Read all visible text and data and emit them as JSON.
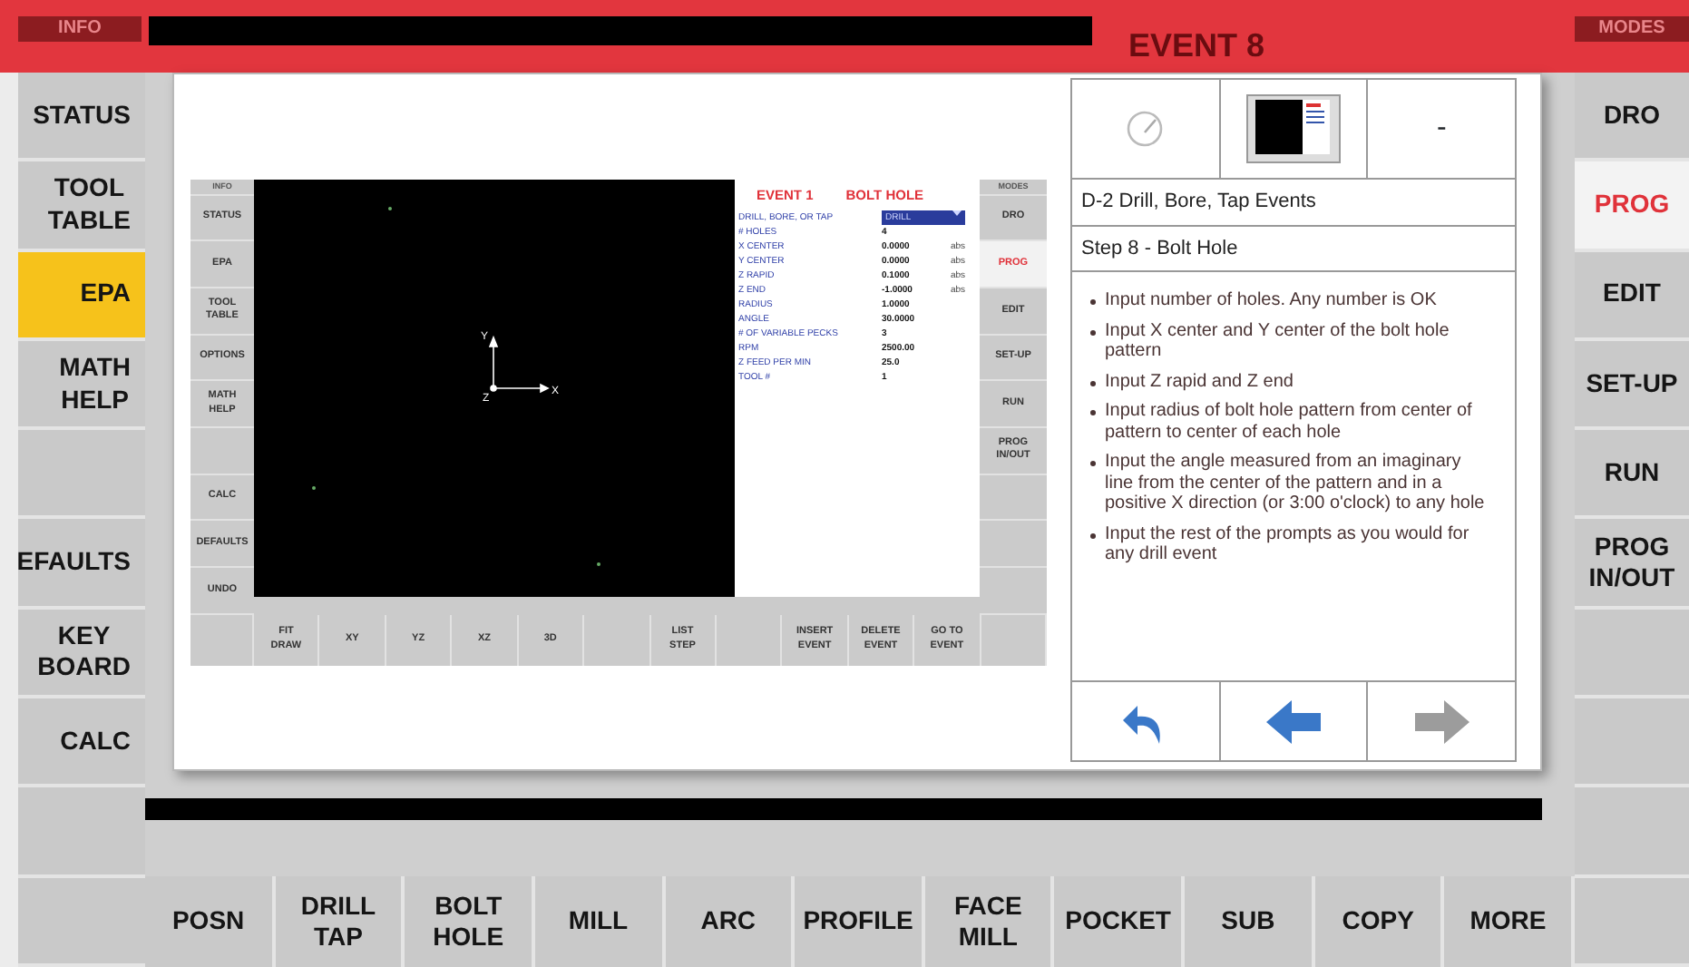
{
  "header": {
    "left_tag": "INFO",
    "event_title": "EVENT 8",
    "right_tag": "MODES"
  },
  "left_menu": [
    {
      "kind": "button",
      "label": "STATUS",
      "selected": false
    },
    {
      "kind": "button",
      "label": "TOOL\nTABLE",
      "selected": false
    },
    {
      "kind": "button",
      "label": "EPA",
      "selected": true
    },
    {
      "kind": "button",
      "label": "MATH\nHELP",
      "selected": false
    },
    {
      "kind": "blank"
    },
    {
      "kind": "button",
      "label": "EFAULTS",
      "selected": false
    },
    {
      "kind": "button",
      "label": "KEY\nBOARD",
      "selected": false
    },
    {
      "kind": "button",
      "label": "CALC",
      "selected": false
    },
    {
      "kind": "blank"
    },
    {
      "kind": "blank"
    }
  ],
  "right_menu": [
    {
      "kind": "button",
      "label": "DRO",
      "selected": false
    },
    {
      "kind": "button",
      "label": "PROG",
      "selected": true
    },
    {
      "kind": "button",
      "label": "EDIT",
      "selected": false
    },
    {
      "kind": "button",
      "label": "SET-UP",
      "selected": false
    },
    {
      "kind": "button",
      "label": "RUN",
      "selected": false
    },
    {
      "kind": "button",
      "label": "PROG\nIN/OUT",
      "selected": false
    },
    {
      "kind": "blank"
    },
    {
      "kind": "blank"
    },
    {
      "kind": "blank"
    },
    {
      "kind": "blank"
    }
  ],
  "inner_screen": {
    "left_menu": [
      {
        "kind": "tag",
        "label": "INFO"
      },
      {
        "kind": "button",
        "label": "STATUS"
      },
      {
        "kind": "button",
        "label": "EPA"
      },
      {
        "kind": "button",
        "label": "TOOL\nTABLE"
      },
      {
        "kind": "button",
        "label": "OPTIONS"
      },
      {
        "kind": "button",
        "label": "MATH\nHELP"
      },
      {
        "kind": "blank"
      },
      {
        "kind": "button",
        "label": "CALC"
      },
      {
        "kind": "button",
        "label": "DEFAULTS"
      },
      {
        "kind": "button",
        "label": "UNDO"
      }
    ],
    "axis_labels": {
      "y": "Y",
      "x": "X",
      "z": "Z"
    },
    "event": {
      "number": "EVENT 1",
      "name": "BOLT HOLE"
    },
    "fields": [
      {
        "kind": "dropdown",
        "label": "DRILL, BORE, OR TAP",
        "value": "DRILL"
      },
      {
        "kind": "value",
        "label": "# HOLES",
        "value": "4"
      },
      {
        "kind": "value",
        "label": "X CENTER",
        "value": "0.0000",
        "unit": "abs"
      },
      {
        "kind": "value",
        "label": "Y CENTER",
        "value": "0.0000",
        "unit": "abs"
      },
      {
        "kind": "value",
        "label": "Z RAPID",
        "value": "0.1000",
        "unit": "abs"
      },
      {
        "kind": "value",
        "label": "Z END",
        "value": "-1.0000",
        "unit": "abs"
      },
      {
        "kind": "value",
        "label": "RADIUS",
        "value": "1.0000"
      },
      {
        "kind": "value",
        "label": "ANGLE",
        "value": "30.0000"
      },
      {
        "kind": "value",
        "label": "# OF VARIABLE PECKS",
        "value": "3"
      },
      {
        "kind": "value",
        "label": "RPM",
        "value": "2500.00"
      },
      {
        "kind": "value",
        "label": "Z FEED PER MIN",
        "value": "25.0"
      },
      {
        "kind": "value",
        "label": "TOOL #",
        "value": "1"
      }
    ],
    "right_menu": [
      {
        "kind": "tag",
        "label": "MODES"
      },
      {
        "kind": "button",
        "label": "DRO",
        "selected": false
      },
      {
        "kind": "button",
        "label": "PROG",
        "selected": true
      },
      {
        "kind": "button",
        "label": "EDIT",
        "selected": false
      },
      {
        "kind": "button",
        "label": "SET-UP",
        "selected": false
      },
      {
        "kind": "button",
        "label": "RUN",
        "selected": false
      },
      {
        "kind": "button",
        "label": "PROG\nIN/OUT",
        "selected": false
      },
      {
        "kind": "blank"
      },
      {
        "kind": "blank"
      },
      {
        "kind": "blank"
      }
    ],
    "toolbar": [
      {
        "kind": "blank"
      },
      {
        "kind": "button",
        "label": "FIT\nDRAW"
      },
      {
        "kind": "button",
        "label": "XY"
      },
      {
        "kind": "button",
        "label": "YZ"
      },
      {
        "kind": "button",
        "label": "XZ"
      },
      {
        "kind": "button",
        "label": "3D"
      },
      {
        "kind": "blank"
      },
      {
        "kind": "button",
        "label": "LIST\nSTEP"
      },
      {
        "kind": "blank"
      },
      {
        "kind": "button",
        "label": "INSERT\nEVENT"
      },
      {
        "kind": "button",
        "label": "DELETE\nEVENT"
      },
      {
        "kind": "button",
        "label": "GO TO\nEVENT"
      },
      {
        "kind": "blank"
      }
    ]
  },
  "help": {
    "dash": "-",
    "title": "D-2 Drill, Bore, Tap Events",
    "step": "Step 8 - Bolt Hole",
    "bullets": [
      "Input number of holes. Any number is OK",
      "Input X center and Y center of the bolt hole pattern",
      "Input Z rapid and Z end",
      "Input radius of bolt hole pattern from center of pattern to center of each hole",
      "Input the angle measured from an imaginary line from the center of the pattern and in a positive X direction (or 3:00 o'clock) to any hole",
      "Input the rest of the prompts as you would for any drill event"
    ],
    "nav": [
      {
        "kind": "return",
        "disabled": false
      },
      {
        "kind": "back",
        "disabled": false
      },
      {
        "kind": "forward",
        "disabled": true
      }
    ]
  },
  "bottom_bar": [
    "POSN",
    "DRILL\nTAP",
    "BOLT\nHOLE",
    "MILL",
    "ARC",
    "PROFILE",
    "FACE\nMILL",
    "POCKET",
    "SUB",
    "COPY",
    "MORE"
  ]
}
